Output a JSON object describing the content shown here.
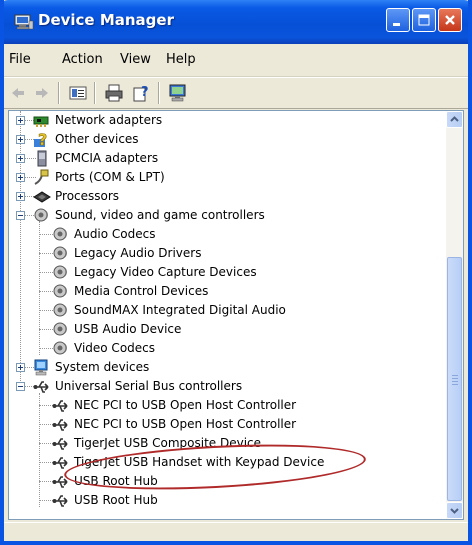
{
  "window": {
    "title": "Device Manager",
    "accent": "#0a54e3"
  },
  "menu": {
    "items": [
      "File",
      "Action",
      "View",
      "Help"
    ]
  },
  "toolbar": {
    "buttons": [
      "back-arrow-icon",
      "forward-arrow-icon",
      "properties-icon",
      "print-icon",
      "help-icon",
      "scan-hardware-icon"
    ]
  },
  "tree": {
    "nodes": [
      {
        "label": "Network adapters",
        "icon": "network-adapter-icon"
      },
      {
        "label": "Other devices",
        "icon": "unknown-device-icon"
      },
      {
        "label": "PCMCIA adapters",
        "icon": "pcmcia-icon"
      },
      {
        "label": "Ports (COM & LPT)",
        "icon": "port-icon"
      },
      {
        "label": "Processors",
        "icon": "processor-icon"
      },
      {
        "label": "Sound, video and game controllers",
        "icon": "sound-icon"
      },
      {
        "label": "Audio Codecs",
        "icon": "sound-device-icon"
      },
      {
        "label": "Legacy Audio Drivers",
        "icon": "sound-device-icon"
      },
      {
        "label": "Legacy Video Capture Devices",
        "icon": "sound-device-icon"
      },
      {
        "label": "Media Control Devices",
        "icon": "sound-device-icon"
      },
      {
        "label": "SoundMAX Integrated Digital Audio",
        "icon": "sound-device-icon"
      },
      {
        "label": "USB Audio Device",
        "icon": "sound-device-icon"
      },
      {
        "label": "Video Codecs",
        "icon": "sound-device-icon"
      },
      {
        "label": "System devices",
        "icon": "system-device-icon"
      },
      {
        "label": "Universal Serial Bus controllers",
        "icon": "usb-icon"
      },
      {
        "label": "NEC PCI to USB Open Host Controller",
        "icon": "usb-icon"
      },
      {
        "label": "NEC PCI to USB Open Host Controller",
        "icon": "usb-icon"
      },
      {
        "label": "TigerJet USB Composite Device",
        "icon": "usb-icon"
      },
      {
        "label": "TigerJet USB Handset with Keypad Device",
        "icon": "usb-icon"
      },
      {
        "label": "USB Root Hub",
        "icon": "usb-icon"
      },
      {
        "label": "USB Root Hub",
        "icon": "usb-icon"
      }
    ]
  },
  "annotation": {
    "color": "#b02a2a"
  }
}
